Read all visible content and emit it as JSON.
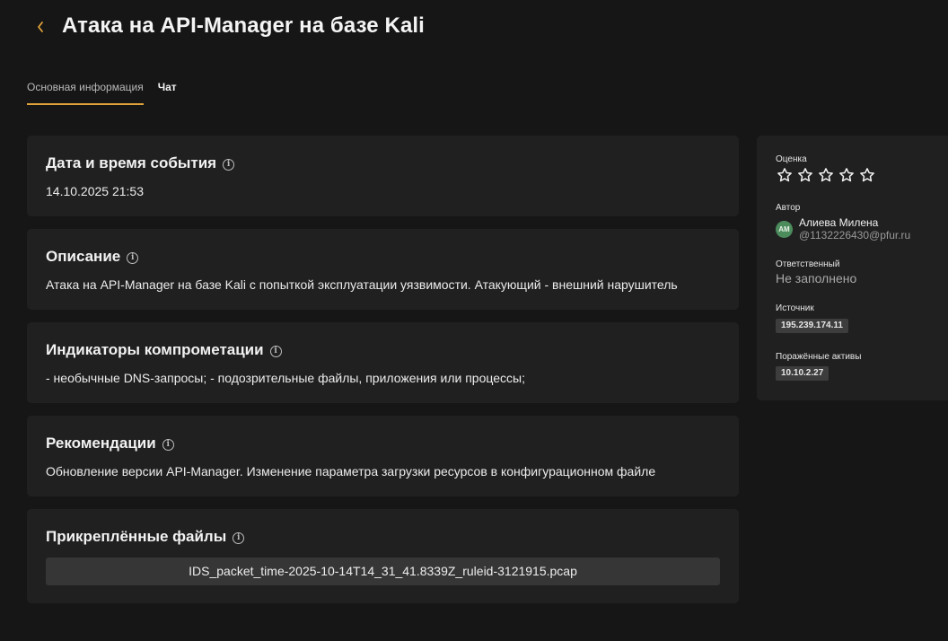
{
  "header": {
    "back_icon": "chevron-left-icon",
    "title": "Атака на API-Manager на базе Kali"
  },
  "tabs": [
    {
      "label": "Основная информация",
      "active": true
    },
    {
      "label": "Чат",
      "active": false
    }
  ],
  "sections": {
    "datetime": {
      "title": "Дата и время события",
      "value": "14.10.2025 21:53"
    },
    "description": {
      "title": "Описание",
      "value": "Атака на API-Manager на базе Kali с попыткой эксплуатации уязвимости. Атакующий - внешний нарушитель"
    },
    "indicators": {
      "title": "Индикаторы компрометации",
      "value": "- необычные DNS-запросы; - подозрительные файлы, приложения или процессы;"
    },
    "recommendations": {
      "title": "Рекомендации",
      "value": "Обновление версии API-Manager. Изменение параметра загрузки ресурсов в конфигурационном файле"
    },
    "files": {
      "title": "Прикреплённые файлы",
      "items": [
        "IDS_packet_time-2025-10-14T14_31_41.8339Z_ruleid-3121915.pcap"
      ]
    }
  },
  "info_icon": "info-icon",
  "sidebar": {
    "rating": {
      "label": "Оценка",
      "value": 0,
      "max": 5
    },
    "author": {
      "label": "Автор",
      "initials": "АМ",
      "name": "Алиева Милена",
      "email": "@1132226430@pfur.ru"
    },
    "responsible": {
      "label": "Ответственный",
      "value": "Не заполнено"
    },
    "source": {
      "label": "Источник",
      "value": "195.239.174.11"
    },
    "assets": {
      "label": "Поражённые активы",
      "value": "10.10.2.27"
    }
  },
  "colors": {
    "background": "#161616",
    "card": "#202020",
    "accent": "#e0a23b",
    "avatar": "#4c8c5c"
  }
}
